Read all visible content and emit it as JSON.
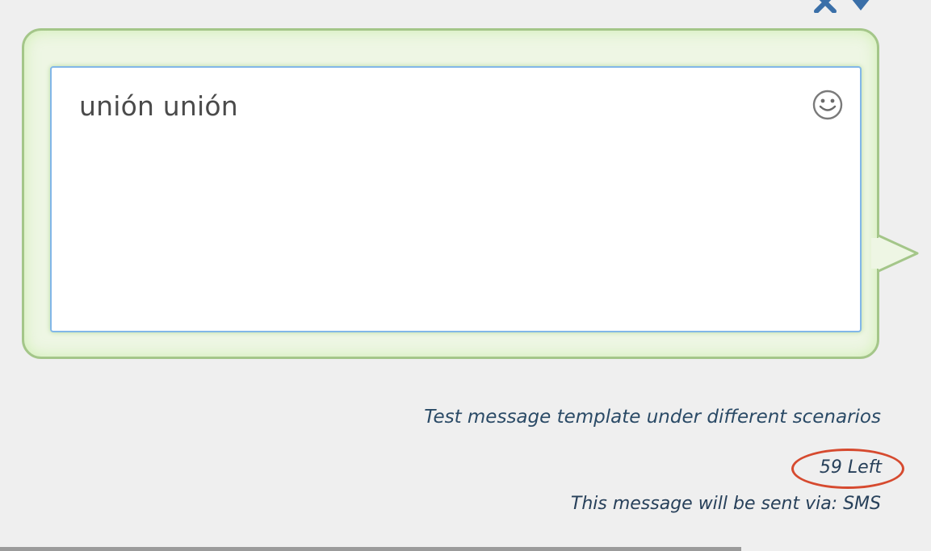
{
  "top_icons": [
    {
      "name": "close-icon",
      "symbol": "×"
    },
    {
      "name": "chevron-down-icon",
      "symbol": "▼"
    }
  ],
  "composer": {
    "message_text": "unión unión",
    "emoji_icon": "smiley-icon"
  },
  "footer": {
    "test_link": "Test message template under different scenarios",
    "chars_left": "59 Left",
    "send_via": "This message will be sent via: SMS"
  },
  "colors": {
    "bubble_border": "#a4c689",
    "bubble_fill": "#eef6e4",
    "input_border": "#82b7e8",
    "footer_text": "#27405a",
    "highlight_circle": "#d64a2f",
    "icon_blue": "#3a6fa8"
  }
}
